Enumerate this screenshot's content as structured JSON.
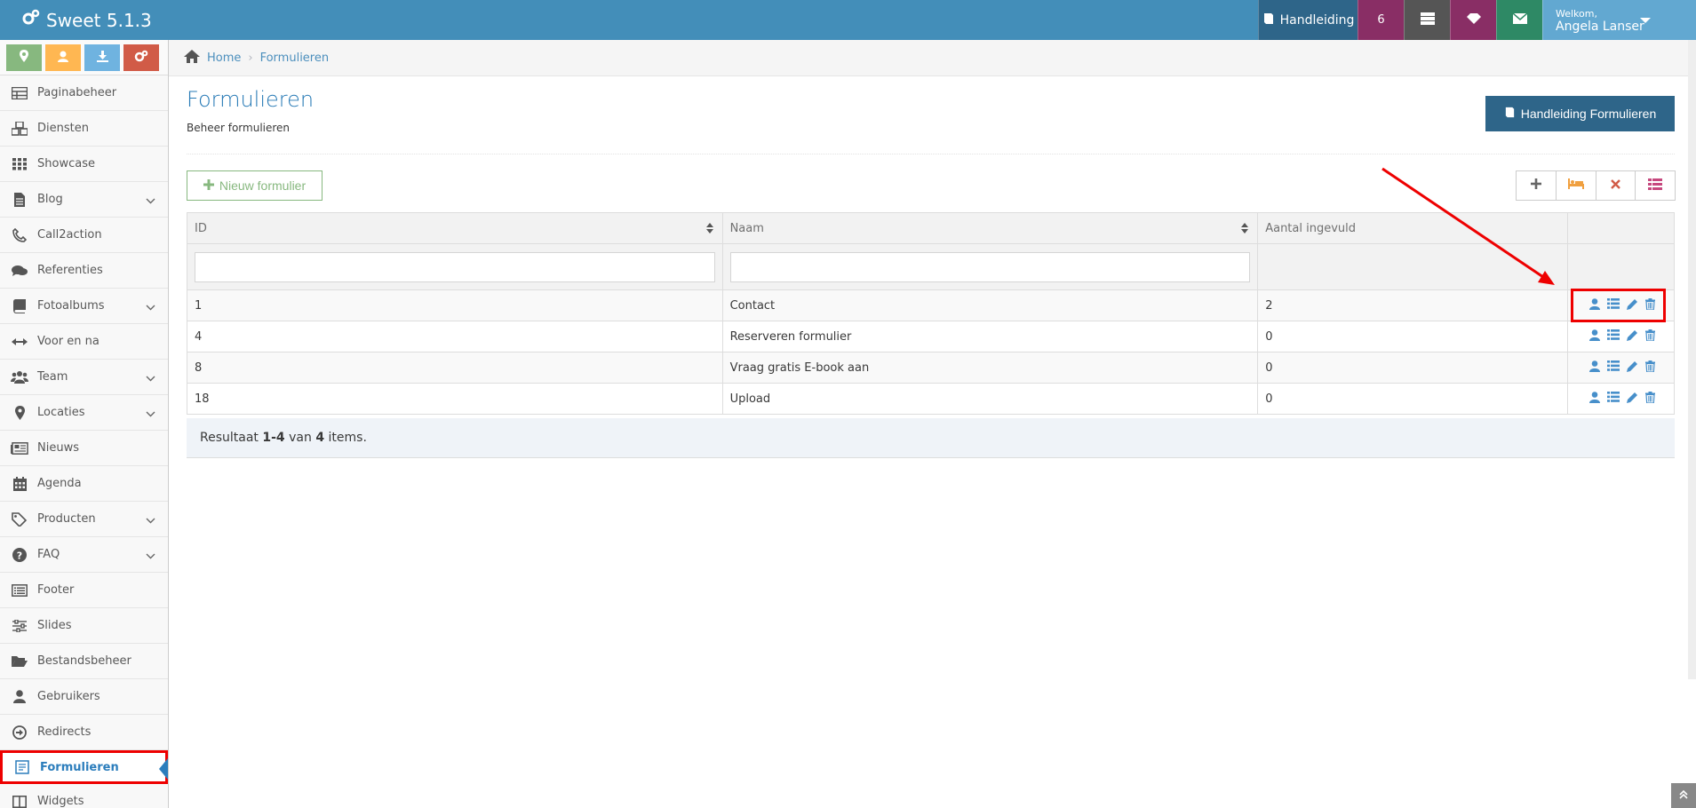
{
  "app": {
    "title": "Sweet 5.1.3"
  },
  "navbar": {
    "handleiding_label": "Handleiding",
    "notifications_count": "6",
    "user_greeting": "Welkom,",
    "user_name": "Angela Lanser"
  },
  "sidebar": {
    "items": [
      {
        "label": "Paginabeheer",
        "icon": "table-icon",
        "has_submenu": false
      },
      {
        "label": "Diensten",
        "icon": "cubes-icon",
        "has_submenu": false
      },
      {
        "label": "Showcase",
        "icon": "grid-icon",
        "has_submenu": false
      },
      {
        "label": "Blog",
        "icon": "file-text-icon",
        "has_submenu": true
      },
      {
        "label": "Call2action",
        "icon": "phone-icon",
        "has_submenu": false
      },
      {
        "label": "Referenties",
        "icon": "comments-icon",
        "has_submenu": false
      },
      {
        "label": "Fotoalbums",
        "icon": "book-icon",
        "has_submenu": true
      },
      {
        "label": "Voor en na",
        "icon": "arrows-h-icon",
        "has_submenu": false
      },
      {
        "label": "Team",
        "icon": "users-icon",
        "has_submenu": true
      },
      {
        "label": "Locaties",
        "icon": "map-marker-icon",
        "has_submenu": true
      },
      {
        "label": "Nieuws",
        "icon": "newspaper-icon",
        "has_submenu": false
      },
      {
        "label": "Agenda",
        "icon": "calendar-icon",
        "has_submenu": false
      },
      {
        "label": "Producten",
        "icon": "tags-icon",
        "has_submenu": true
      },
      {
        "label": "FAQ",
        "icon": "question-circle-icon",
        "has_submenu": true
      },
      {
        "label": "Footer",
        "icon": "list-alt-icon",
        "has_submenu": false
      },
      {
        "label": "Slides",
        "icon": "sliders-icon",
        "has_submenu": false
      },
      {
        "label": "Bestandsbeheer",
        "icon": "folder-open-icon",
        "has_submenu": false
      },
      {
        "label": "Gebruikers",
        "icon": "user-icon",
        "has_submenu": false
      },
      {
        "label": "Redirects",
        "icon": "arrow-circle-right-icon",
        "has_submenu": false
      },
      {
        "label": "Formulieren",
        "icon": "form-icon",
        "has_submenu": false,
        "active": true
      },
      {
        "label": "Widgets",
        "icon": "columns-icon",
        "has_submenu": false
      }
    ]
  },
  "breadcrumb": {
    "home": "Home",
    "current": "Formulieren"
  },
  "page": {
    "title": "Formulieren",
    "subtitle": "Beheer formulieren",
    "manual_button": "Handleiding Formulieren",
    "new_button": "Nieuw formulier"
  },
  "table": {
    "columns": [
      "ID",
      "Naam",
      "Aantal ingevuld",
      ""
    ],
    "rows": [
      {
        "id": "1",
        "naam": "Contact",
        "aantal": "2"
      },
      {
        "id": "4",
        "naam": "Reserveren formulier",
        "aantal": "0"
      },
      {
        "id": "8",
        "naam": "Vraag gratis E-book aan",
        "aantal": "0"
      },
      {
        "id": "18",
        "naam": "Upload",
        "aantal": "0"
      }
    ]
  },
  "summary": {
    "prefix": "Resultaat",
    "range": "1-4",
    "middle": "van",
    "total": "4",
    "suffix": "items."
  },
  "colors": {
    "navbar": "#438eb9",
    "accent": "#2679b5",
    "highlight": "#e00000",
    "new_button": "#87b87f"
  }
}
